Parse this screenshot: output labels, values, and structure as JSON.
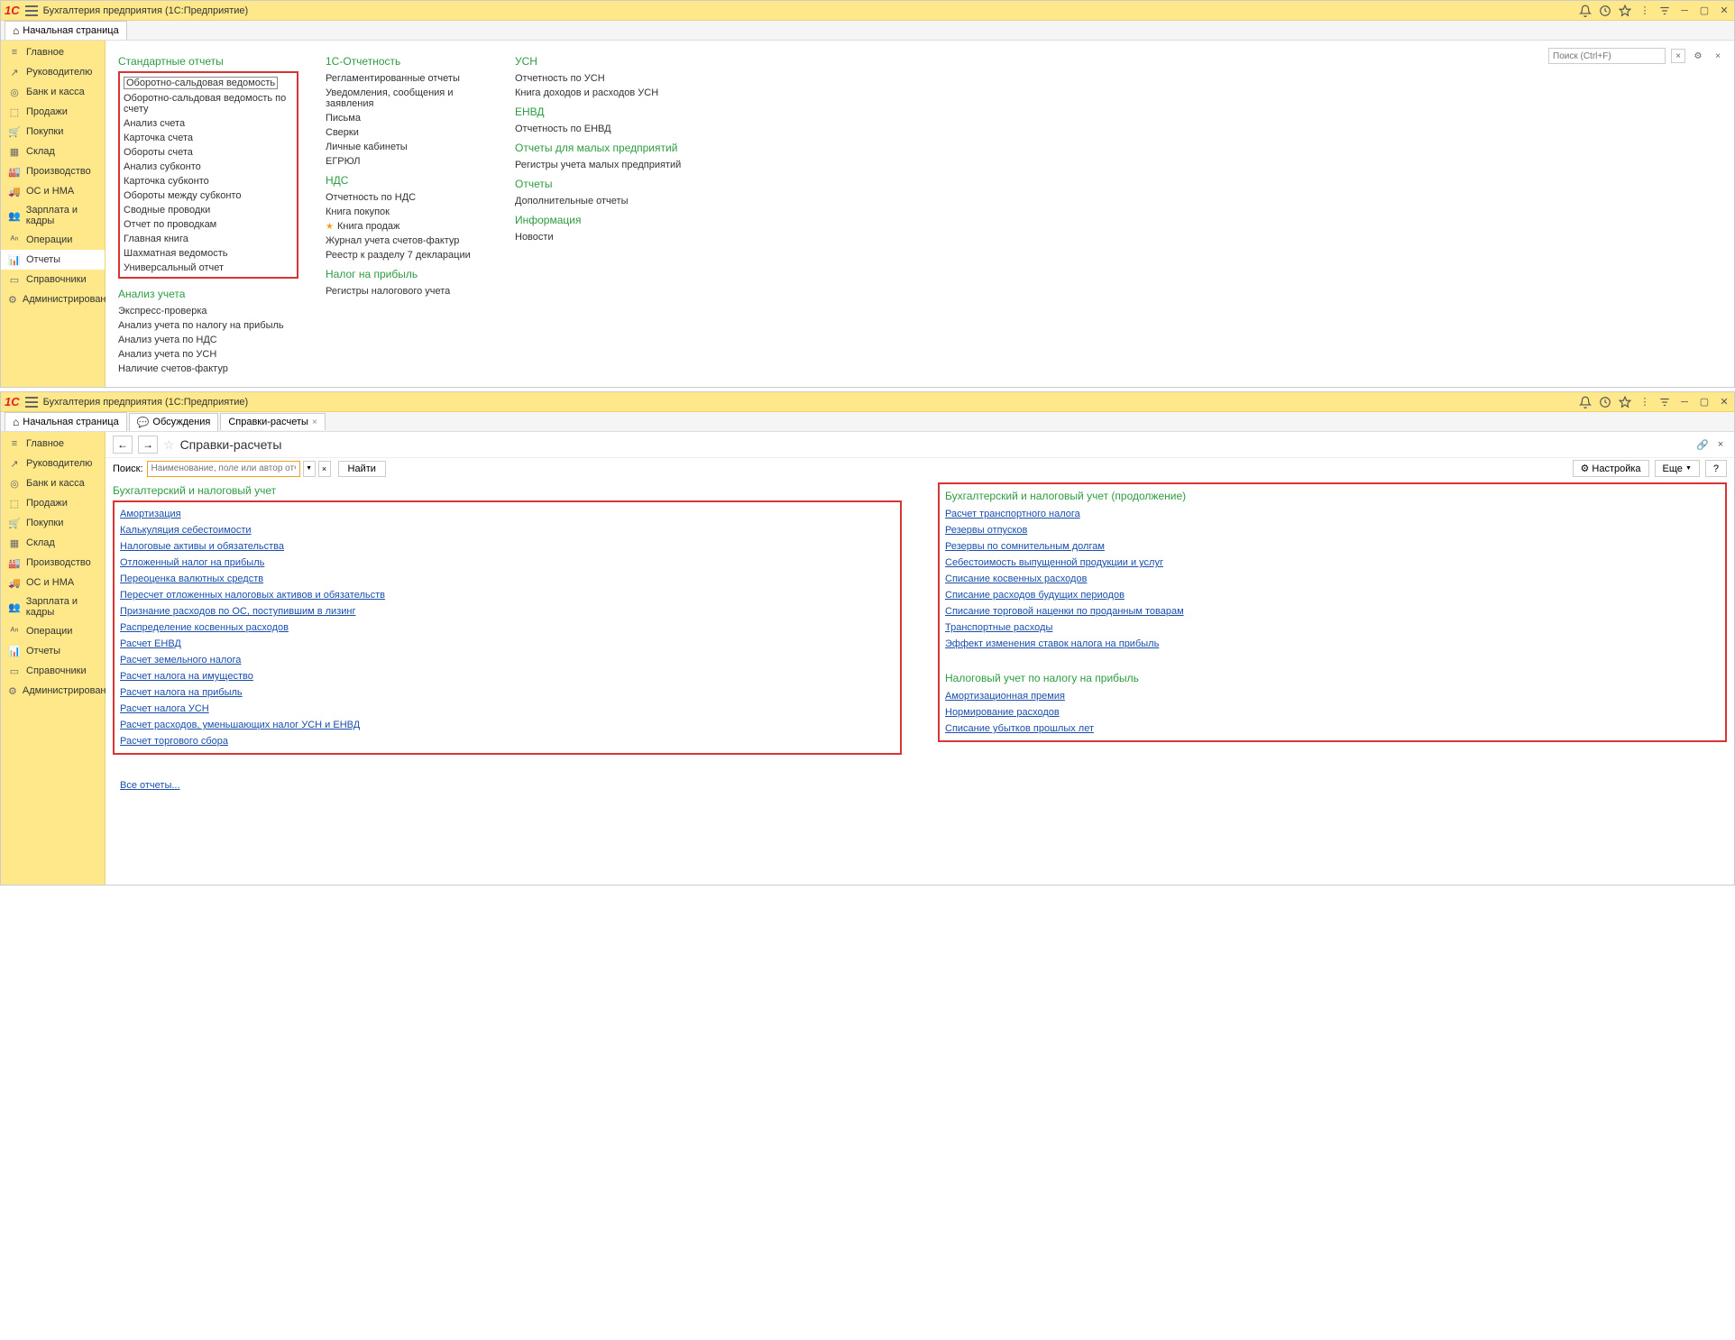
{
  "title": "Бухгалтерия предприятия  (1С:Предприятие)",
  "tabs": {
    "home": "Начальная страница"
  },
  "sidebar": {
    "items": [
      "Главное",
      "Руководителю",
      "Банк и касса",
      "Продажи",
      "Покупки",
      "Склад",
      "Производство",
      "ОС и НМА",
      "Зарплата и кадры",
      "Операции",
      "Отчеты",
      "Справочники",
      "Администрирование"
    ]
  },
  "search": {
    "placeholder": "Поиск (Ctrl+F)"
  },
  "reports": {
    "col1": {
      "standard": {
        "title": "Стандартные отчеты",
        "items": [
          "Оборотно-сальдовая ведомость",
          "Оборотно-сальдовая ведомость по счету",
          "Анализ счета",
          "Карточка счета",
          "Обороты счета",
          "Анализ субконто",
          "Карточка субконто",
          "Обороты между субконто",
          "Сводные проводки",
          "Отчет по проводкам",
          "Главная книга",
          "Шахматная ведомость",
          "Универсальный отчет"
        ]
      },
      "analysis": {
        "title": "Анализ учета",
        "items": [
          "Экспресс-проверка",
          "Анализ учета по налогу на прибыль",
          "Анализ учета по НДС",
          "Анализ учета по УСН",
          "Наличие счетов-фактур"
        ]
      }
    },
    "col2": {
      "onec": {
        "title": "1С-Отчетность",
        "items": [
          "Регламентированные отчеты",
          "Уведомления, сообщения и заявления",
          "Письма",
          "Сверки",
          "Личные кабинеты",
          "ЕГРЮЛ"
        ]
      },
      "nds": {
        "title": "НДС",
        "items": [
          "Отчетность по НДС",
          "Книга покупок",
          "Книга продаж",
          "Журнал учета счетов-фактур",
          "Реестр к разделу 7 декларации"
        ]
      },
      "profit": {
        "title": "Налог на прибыль",
        "items": [
          "Регистры налогового учета"
        ]
      }
    },
    "col3": {
      "usn": {
        "title": "УСН",
        "items": [
          "Отчетность по УСН",
          "Книга доходов и расходов УСН"
        ]
      },
      "envd": {
        "title": "ЕНВД",
        "items": [
          "Отчетность по ЕНВД"
        ]
      },
      "small": {
        "title": "Отчеты для малых предприятий",
        "items": [
          "Регистры учета малых предприятий"
        ]
      },
      "more": {
        "title": "Отчеты",
        "items": [
          "Дополнительные отчеты"
        ]
      },
      "info": {
        "title": "Информация",
        "items": [
          "Новости"
        ]
      }
    }
  },
  "win2": {
    "tabs": {
      "home": "Начальная страница",
      "disc": "Обсуждения",
      "sr": "Справки-расчеты"
    },
    "page_title": "Справки-расчеты",
    "search_label": "Поиск:",
    "search_placeholder": "Наименование, поле или автор отчета",
    "find": "Найти",
    "settings": "Настройка",
    "more": "Еще",
    "left": {
      "title": "Бухгалтерский и налоговый учет",
      "items": [
        "Амортизация",
        "Калькуляция себестоимости",
        "Налоговые активы и обязательства",
        "Отложенный налог на прибыль",
        "Переоценка валютных средств",
        "Пересчет отложенных налоговых активов и обязательств",
        "Признание расходов по ОС, поступившим в лизинг",
        "Распределение косвенных расходов",
        "Расчет ЕНВД",
        "Расчет земельного налога",
        "Расчет налога на имущество",
        "Расчет налога на прибыль",
        "Расчет налога УСН",
        "Расчет расходов, уменьшающих налог УСН и ЕНВД",
        "Расчет торгового сбора"
      ]
    },
    "right": {
      "title": "Бухгалтерский и налоговый учет (продолжение)",
      "items": [
        "Расчет транспортного налога",
        "Резервы отпусков",
        "Резервы по сомнительным долгам",
        "Себестоимость выпущенной продукции и услуг",
        "Списание косвенных расходов",
        "Списание расходов будущих периодов",
        "Списание торговой наценки по проданным товарам",
        "Транспортные расходы",
        "Эффект изменения ставок налога на прибыль"
      ],
      "title2": "Налоговый учет по налогу на прибыль",
      "items2": [
        "Амортизационная премия",
        "Нормирование расходов",
        "Списание убытков прошлых лет"
      ]
    },
    "all": "Все отчеты..."
  }
}
